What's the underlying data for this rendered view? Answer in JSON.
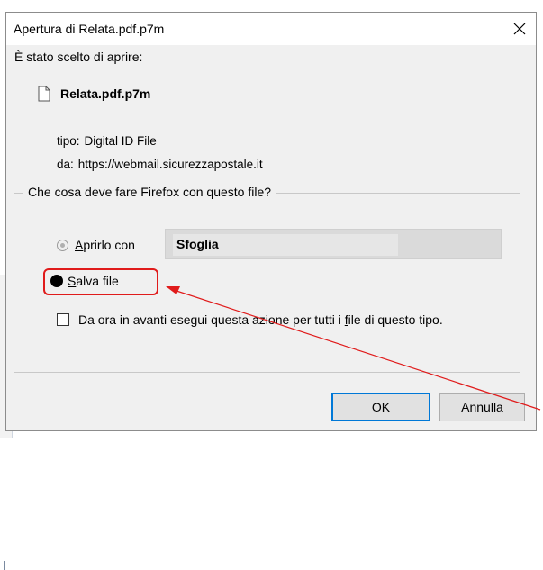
{
  "dialog": {
    "title": "Apertura di Relata.pdf.p7m",
    "intro": "È stato scelto di aprire:",
    "file": {
      "name": "Relata.pdf.p7m",
      "type_label": "tipo:",
      "type_value": "Digital ID File",
      "from_label": "da:",
      "from_value": "https://webmail.sicurezzapostale.it"
    },
    "action_group": {
      "legend": "Che cosa deve fare Firefox con questo file?",
      "open_with": {
        "accesskey": "A",
        "rest": "prirlo con",
        "app": "Sfoglia",
        "selected": false
      },
      "save_file": {
        "accesskey": "S",
        "rest": "alva file",
        "selected": true
      },
      "remember": {
        "before": "Da ora in avanti esegui questa azione per tutti i ",
        "accesskey": "f",
        "after": "ile di questo tipo.",
        "checked": false
      }
    },
    "buttons": {
      "ok": "OK",
      "cancel": "Annulla"
    }
  },
  "annotation": {
    "color": "#e01b1b"
  },
  "icons": {
    "close": "close-icon",
    "file": "document-icon"
  }
}
